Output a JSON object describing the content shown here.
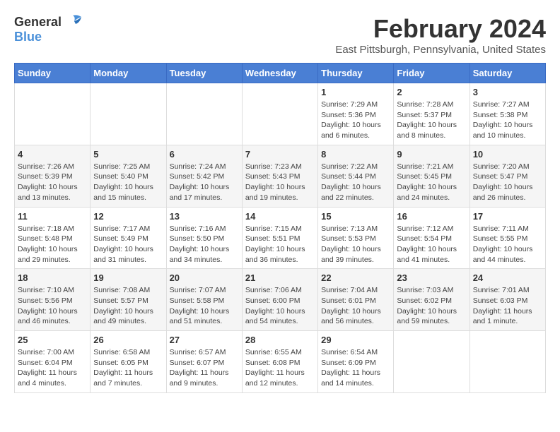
{
  "header": {
    "logo_general": "General",
    "logo_blue": "Blue",
    "month_title": "February 2024",
    "location": "East Pittsburgh, Pennsylvania, United States"
  },
  "weekdays": [
    "Sunday",
    "Monday",
    "Tuesday",
    "Wednesday",
    "Thursday",
    "Friday",
    "Saturday"
  ],
  "weeks": [
    [
      {
        "day": "",
        "info": ""
      },
      {
        "day": "",
        "info": ""
      },
      {
        "day": "",
        "info": ""
      },
      {
        "day": "",
        "info": ""
      },
      {
        "day": "1",
        "info": "Sunrise: 7:29 AM\nSunset: 5:36 PM\nDaylight: 10 hours\nand 6 minutes."
      },
      {
        "day": "2",
        "info": "Sunrise: 7:28 AM\nSunset: 5:37 PM\nDaylight: 10 hours\nand 8 minutes."
      },
      {
        "day": "3",
        "info": "Sunrise: 7:27 AM\nSunset: 5:38 PM\nDaylight: 10 hours\nand 10 minutes."
      }
    ],
    [
      {
        "day": "4",
        "info": "Sunrise: 7:26 AM\nSunset: 5:39 PM\nDaylight: 10 hours\nand 13 minutes."
      },
      {
        "day": "5",
        "info": "Sunrise: 7:25 AM\nSunset: 5:40 PM\nDaylight: 10 hours\nand 15 minutes."
      },
      {
        "day": "6",
        "info": "Sunrise: 7:24 AM\nSunset: 5:42 PM\nDaylight: 10 hours\nand 17 minutes."
      },
      {
        "day": "7",
        "info": "Sunrise: 7:23 AM\nSunset: 5:43 PM\nDaylight: 10 hours\nand 19 minutes."
      },
      {
        "day": "8",
        "info": "Sunrise: 7:22 AM\nSunset: 5:44 PM\nDaylight: 10 hours\nand 22 minutes."
      },
      {
        "day": "9",
        "info": "Sunrise: 7:21 AM\nSunset: 5:45 PM\nDaylight: 10 hours\nand 24 minutes."
      },
      {
        "day": "10",
        "info": "Sunrise: 7:20 AM\nSunset: 5:47 PM\nDaylight: 10 hours\nand 26 minutes."
      }
    ],
    [
      {
        "day": "11",
        "info": "Sunrise: 7:18 AM\nSunset: 5:48 PM\nDaylight: 10 hours\nand 29 minutes."
      },
      {
        "day": "12",
        "info": "Sunrise: 7:17 AM\nSunset: 5:49 PM\nDaylight: 10 hours\nand 31 minutes."
      },
      {
        "day": "13",
        "info": "Sunrise: 7:16 AM\nSunset: 5:50 PM\nDaylight: 10 hours\nand 34 minutes."
      },
      {
        "day": "14",
        "info": "Sunrise: 7:15 AM\nSunset: 5:51 PM\nDaylight: 10 hours\nand 36 minutes."
      },
      {
        "day": "15",
        "info": "Sunrise: 7:13 AM\nSunset: 5:53 PM\nDaylight: 10 hours\nand 39 minutes."
      },
      {
        "day": "16",
        "info": "Sunrise: 7:12 AM\nSunset: 5:54 PM\nDaylight: 10 hours\nand 41 minutes."
      },
      {
        "day": "17",
        "info": "Sunrise: 7:11 AM\nSunset: 5:55 PM\nDaylight: 10 hours\nand 44 minutes."
      }
    ],
    [
      {
        "day": "18",
        "info": "Sunrise: 7:10 AM\nSunset: 5:56 PM\nDaylight: 10 hours\nand 46 minutes."
      },
      {
        "day": "19",
        "info": "Sunrise: 7:08 AM\nSunset: 5:57 PM\nDaylight: 10 hours\nand 49 minutes."
      },
      {
        "day": "20",
        "info": "Sunrise: 7:07 AM\nSunset: 5:58 PM\nDaylight: 10 hours\nand 51 minutes."
      },
      {
        "day": "21",
        "info": "Sunrise: 7:06 AM\nSunset: 6:00 PM\nDaylight: 10 hours\nand 54 minutes."
      },
      {
        "day": "22",
        "info": "Sunrise: 7:04 AM\nSunset: 6:01 PM\nDaylight: 10 hours\nand 56 minutes."
      },
      {
        "day": "23",
        "info": "Sunrise: 7:03 AM\nSunset: 6:02 PM\nDaylight: 10 hours\nand 59 minutes."
      },
      {
        "day": "24",
        "info": "Sunrise: 7:01 AM\nSunset: 6:03 PM\nDaylight: 11 hours\nand 1 minute."
      }
    ],
    [
      {
        "day": "25",
        "info": "Sunrise: 7:00 AM\nSunset: 6:04 PM\nDaylight: 11 hours\nand 4 minutes."
      },
      {
        "day": "26",
        "info": "Sunrise: 6:58 AM\nSunset: 6:05 PM\nDaylight: 11 hours\nand 7 minutes."
      },
      {
        "day": "27",
        "info": "Sunrise: 6:57 AM\nSunset: 6:07 PM\nDaylight: 11 hours\nand 9 minutes."
      },
      {
        "day": "28",
        "info": "Sunrise: 6:55 AM\nSunset: 6:08 PM\nDaylight: 11 hours\nand 12 minutes."
      },
      {
        "day": "29",
        "info": "Sunrise: 6:54 AM\nSunset: 6:09 PM\nDaylight: 11 hours\nand 14 minutes."
      },
      {
        "day": "",
        "info": ""
      },
      {
        "day": "",
        "info": ""
      }
    ]
  ]
}
